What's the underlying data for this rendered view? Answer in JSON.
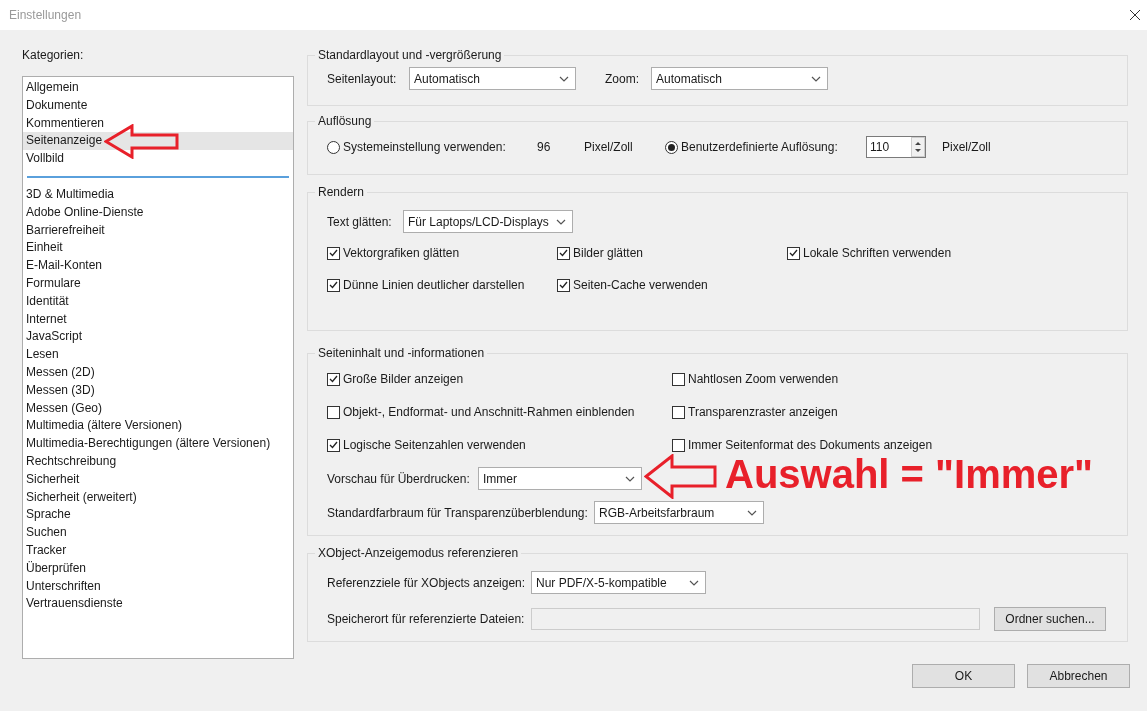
{
  "window": {
    "title": "Einstellungen"
  },
  "categories": {
    "label": "Kategorien:",
    "groups": [
      {
        "items": [
          {
            "label": "Allgemein",
            "selected": false
          },
          {
            "label": "Dokumente",
            "selected": false
          },
          {
            "label": "Kommentieren",
            "selected": false
          },
          {
            "label": "Seitenanzeige",
            "selected": true
          },
          {
            "label": "Vollbild",
            "selected": false
          }
        ]
      },
      {
        "items": [
          {
            "label": "3D & Multimedia",
            "selected": false
          },
          {
            "label": "Adobe Online-Dienste",
            "selected": false
          },
          {
            "label": "Barrierefreiheit",
            "selected": false
          },
          {
            "label": "Einheit",
            "selected": false
          },
          {
            "label": "E-Mail-Konten",
            "selected": false
          },
          {
            "label": "Formulare",
            "selected": false
          },
          {
            "label": "Identität",
            "selected": false
          },
          {
            "label": "Internet",
            "selected": false
          },
          {
            "label": "JavaScript",
            "selected": false
          },
          {
            "label": "Lesen",
            "selected": false
          },
          {
            "label": "Messen (2D)",
            "selected": false
          },
          {
            "label": "Messen (3D)",
            "selected": false
          },
          {
            "label": "Messen (Geo)",
            "selected": false
          },
          {
            "label": "Multimedia (ältere Versionen)",
            "selected": false
          },
          {
            "label": "Multimedia-Berechtigungen (ältere Versionen)",
            "selected": false
          },
          {
            "label": "Rechtschreibung",
            "selected": false
          },
          {
            "label": "Sicherheit",
            "selected": false
          },
          {
            "label": "Sicherheit (erweitert)",
            "selected": false
          },
          {
            "label": "Sprache",
            "selected": false
          },
          {
            "label": "Suchen",
            "selected": false
          },
          {
            "label": "Tracker",
            "selected": false
          },
          {
            "label": "Überprüfen",
            "selected": false
          },
          {
            "label": "Unterschriften",
            "selected": false
          },
          {
            "label": "Vertrauensdienste",
            "selected": false
          }
        ]
      }
    ]
  },
  "layout_section": {
    "title": "Standardlayout und -vergrößerung",
    "fields": [
      {
        "label": "Seitenlayout:",
        "value": "Automatisch"
      },
      {
        "label": "Zoom:",
        "value": "Automatisch"
      }
    ]
  },
  "resolution_section": {
    "title": "Auflösung",
    "options": [
      {
        "kind": "text",
        "label": "Systemeinstellung verwenden:",
        "selected": false,
        "value": "96",
        "unit": "Pixel/Zoll"
      },
      {
        "kind": "spin",
        "label": "Benutzerdefinierte Auflösung:",
        "selected": true,
        "value": "110",
        "unit": "Pixel/Zoll"
      }
    ]
  },
  "render_section": {
    "title": "Rendern",
    "smoothing": {
      "label": "Text glätten:",
      "value": "Für Laptops/LCD-Displays"
    },
    "checkboxes": [
      {
        "label": "Vektorgrafiken glätten",
        "checked": true
      },
      {
        "label": "Bilder glätten",
        "checked": true
      },
      {
        "label": "Lokale Schriften verwenden",
        "checked": true
      },
      {
        "label": "Dünne Linien deutlicher darstellen",
        "checked": true
      },
      {
        "label": "Seiten-Cache verwenden",
        "checked": true
      }
    ]
  },
  "content_section": {
    "title": "Seiteninhalt und -informationen",
    "checkboxes": [
      {
        "label": "Große Bilder anzeigen",
        "checked": true
      },
      {
        "label": "Nahtlosen Zoom verwenden",
        "checked": false
      },
      {
        "label": "Objekt-, Endformat- und Anschnitt-Rahmen einblenden",
        "checked": false
      },
      {
        "label": "Transparenzraster anzeigen",
        "checked": false
      },
      {
        "label": "Logische Seitenzahlen verwenden",
        "checked": true
      },
      {
        "label": "Immer Seitenformat des Dokuments anzeigen",
        "checked": false
      }
    ],
    "dropdowns": [
      {
        "label": "Vorschau für Überdrucken:",
        "value": "Immer"
      },
      {
        "label": "Standardfarbraum für Transparenzüberblendung:",
        "value": "RGB-Arbeitsfarbraum"
      }
    ]
  },
  "xobject_section": {
    "title": "XObject-Anzeigemodus referenzieren",
    "dropdown": {
      "label": "Referenzziele für XObjects anzeigen:",
      "value": "Nur PDF/X-5-kompatible"
    },
    "path_label": "Speicherort für referenzierte Dateien:",
    "browse_button": "Ordner suchen..."
  },
  "buttons": [
    "OK",
    "Abbrechen"
  ],
  "annotation": {
    "text": "Auswahl = \"Immer\""
  }
}
